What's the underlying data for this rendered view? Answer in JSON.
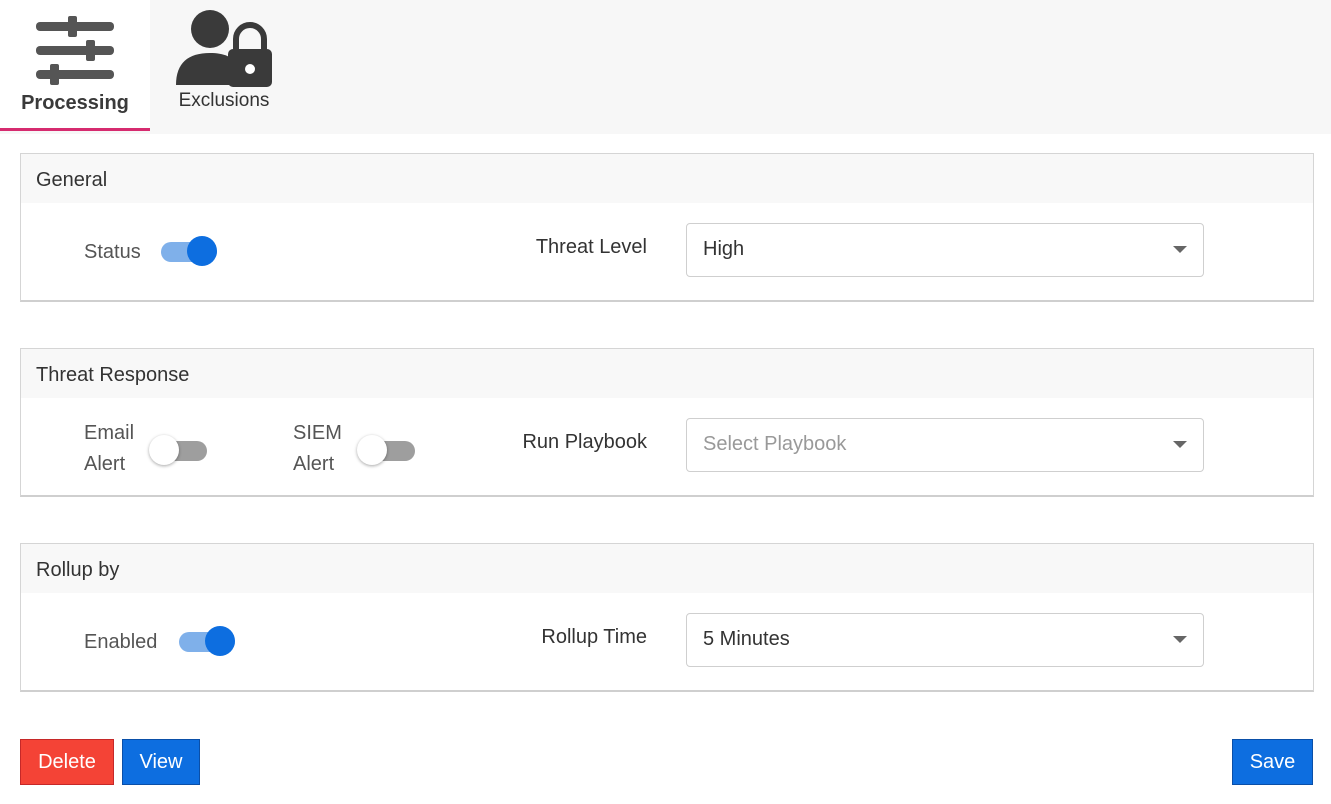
{
  "tabs": [
    {
      "label": "Processing",
      "icon": "sliders-icon",
      "active": true
    },
    {
      "label": "Exclusions",
      "icon": "user-lock-icon",
      "active": false
    }
  ],
  "colors": {
    "accent": "#0d6ee0",
    "tab_underline": "#d62b6f",
    "danger": "#f44336"
  },
  "general": {
    "title": "General",
    "status_label": "Status",
    "status_on": true,
    "threat_level_label": "Threat Level",
    "threat_level_value": "High"
  },
  "threat_response": {
    "title": "Threat Response",
    "email_label_line1": "Email",
    "email_label_line2": "Alert",
    "email_on": false,
    "siem_label_line1": "SIEM",
    "siem_label_line2": "Alert",
    "siem_on": false,
    "playbook_label": "Run Playbook",
    "playbook_placeholder": "Select Playbook"
  },
  "rollup": {
    "title": "Rollup by",
    "enabled_label": "Enabled",
    "enabled_on": true,
    "time_label": "Rollup Time",
    "time_value": "5 Minutes"
  },
  "buttons": {
    "delete": "Delete",
    "view": "View",
    "save": "Save"
  }
}
